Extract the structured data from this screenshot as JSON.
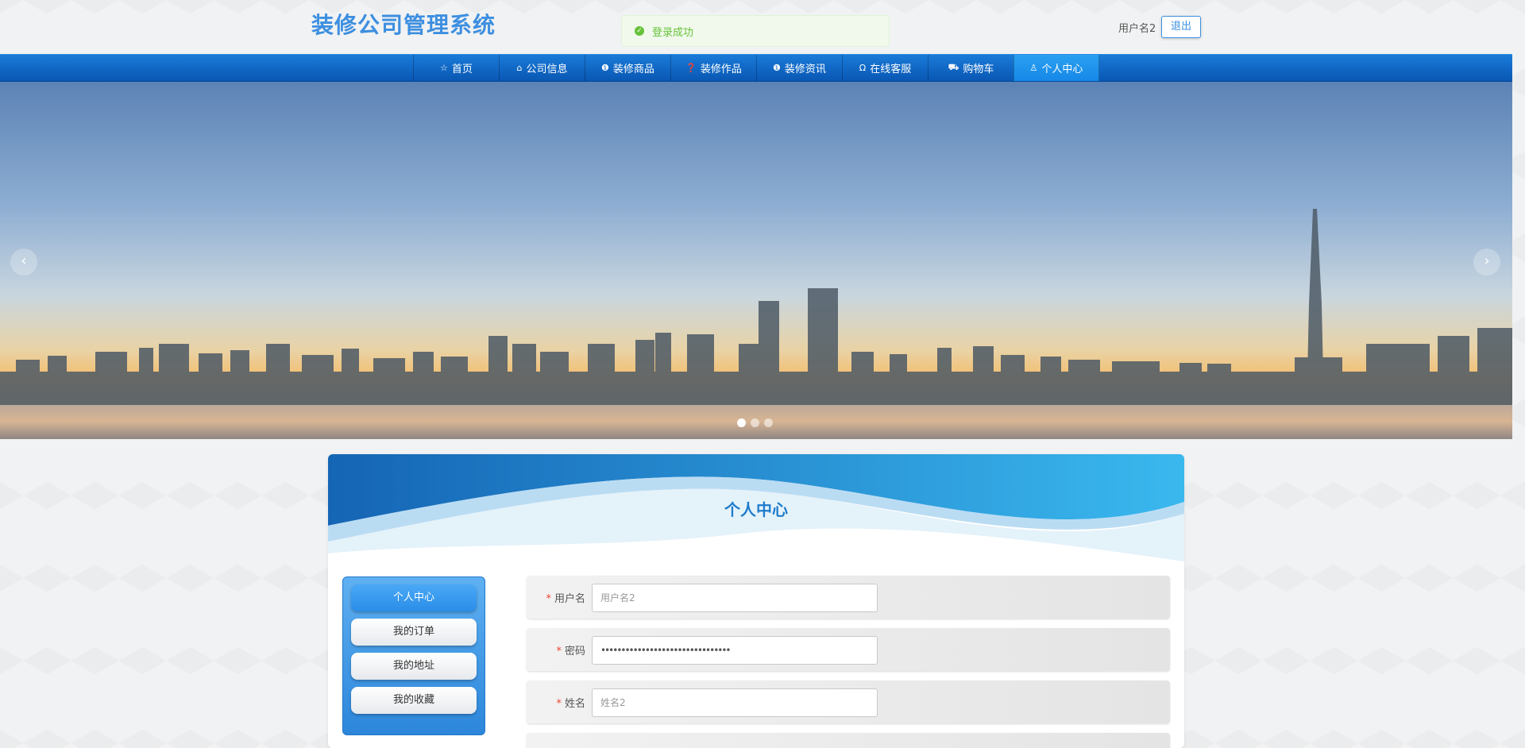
{
  "header": {
    "title": "装修公司管理系统",
    "toast": "登录成功",
    "username": "用户名2",
    "logout_label": "退出"
  },
  "nav": {
    "items": [
      {
        "label": "首页",
        "icon": "star-icon"
      },
      {
        "label": "公司信息",
        "icon": "building-icon"
      },
      {
        "label": "装修商品",
        "icon": "info-icon"
      },
      {
        "label": "装修作品",
        "icon": "question-icon"
      },
      {
        "label": "装修资讯",
        "icon": "info-icon"
      },
      {
        "label": "在线客服",
        "icon": "headset-icon"
      },
      {
        "label": "购物车",
        "icon": "cart-icon"
      },
      {
        "label": "个人中心",
        "icon": "user-icon"
      }
    ],
    "active_index": 7
  },
  "banner": {
    "prev_arrow": "‹",
    "next_arrow": "›",
    "slide_count": 3,
    "active_slide": 0
  },
  "panel": {
    "title": "个人中心",
    "side_menu": [
      "个人中心",
      "我的订单",
      "我的地址",
      "我的收藏"
    ],
    "side_active_index": 0,
    "form": {
      "username": {
        "label": "用户名",
        "placeholder": "用户名2"
      },
      "password": {
        "label": "密码",
        "value": "••••••••••••••••••••••••••••••••"
      },
      "name": {
        "label": "姓名",
        "placeholder": "姓名2"
      }
    }
  },
  "colors": {
    "brand": "#3d8fe0",
    "nav": "#0b63c4",
    "success": "#67c23a",
    "required": "#ee4433"
  }
}
